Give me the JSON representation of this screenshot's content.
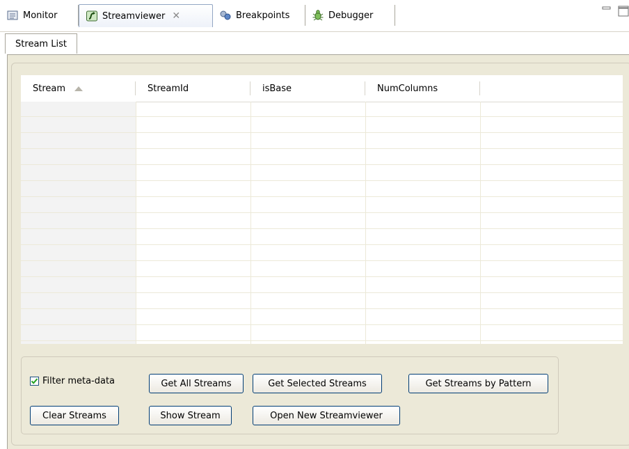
{
  "tabs": [
    {
      "label": "Monitor",
      "icon": "monitor-icon"
    },
    {
      "label": "Streamviewer",
      "icon": "streamviewer-icon",
      "active": true,
      "close": "✕"
    },
    {
      "label": "Breakpoints",
      "icon": "breakpoints-icon"
    },
    {
      "label": "Debugger",
      "icon": "debugger-icon"
    }
  ],
  "inner_tab": {
    "label": "Stream List"
  },
  "table": {
    "columns": [
      "Stream",
      "StreamId",
      "isBase",
      "NumColumns"
    ],
    "sort": {
      "column": "Stream",
      "direction": "ascending"
    },
    "rows": []
  },
  "controls": {
    "filter_meta_data": {
      "label": "Filter meta-data",
      "checked": true
    },
    "get_all_streams": "Get All Streams",
    "get_selected_streams": "Get Selected Streams",
    "get_streams_by_pattern": "Get Streams by Pattern",
    "clear_streams": "Clear Streams",
    "show_stream": "Show Stream",
    "open_new_streamviewer": "Open New Streamviewer"
  },
  "colors": {
    "active_tab_border": "#93a6c4",
    "panel_bg": "#ece9d8",
    "button_border": "#003c74",
    "checkmark": "#21a121"
  }
}
